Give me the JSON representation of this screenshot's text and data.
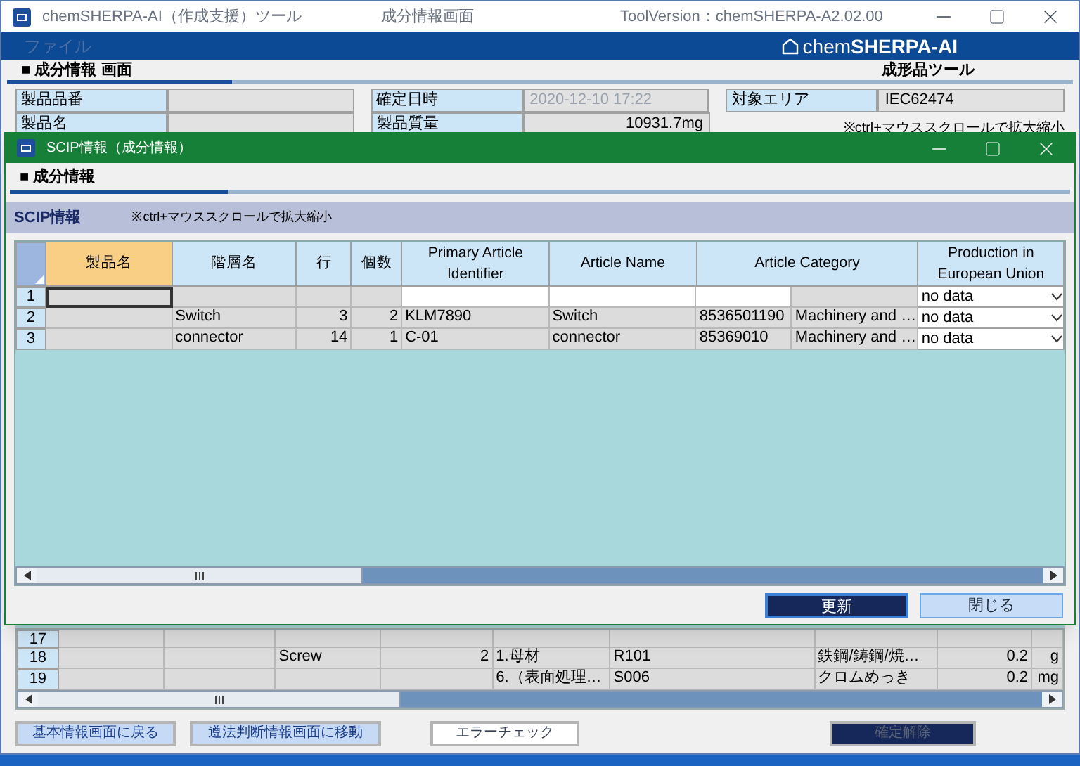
{
  "window": {
    "title": "chemSHERPA-AI（作成支援）ツール",
    "screen_name": "成分情報画面",
    "version": "ToolVersion：chemSHERPA-A2.02.00"
  },
  "menu": [
    {
      "label": "ファイル",
      "disabled": true
    }
  ],
  "logo": {
    "prefix": "chem",
    "brand": "SHERPA-AI"
  },
  "section": {
    "title": "■ 成分情報 画面",
    "subtitle": "成形品ツール"
  },
  "info_rows": [
    [
      {
        "label": "製品品番"
      },
      {
        "label": "確定日時",
        "value": "2020-12-10 17:22",
        "disabled": true
      },
      {
        "label": "対象エリア",
        "value": "IEC62474",
        "disabled": false
      }
    ],
    [
      {
        "label": "製品名"
      },
      {
        "label": "製品質量",
        "value": "10931.7mg",
        "disabled": false
      },
      {
        "hint": "※ctrl+マウススクロールで拡大縮小"
      }
    ]
  ],
  "dialog": {
    "title": "SCIP情報（成分情報）",
    "section": "■ 成分情報",
    "bar_title": "SCIP情報",
    "hint": "※ctrl+マウススクロールで拡大縮小",
    "columns": [
      {
        "label": "製品名",
        "selected": true
      },
      {
        "label": "階層名",
        "selected": false
      },
      {
        "label": "行",
        "selected": false
      },
      {
        "label": "個数",
        "selected": false
      },
      {
        "label": "Primary Article Identifier",
        "selected": false
      },
      {
        "label": "Article Name",
        "selected": false
      },
      {
        "label": "Article Category",
        "selected": false
      },
      {
        "label": "Production in European Union",
        "selected": false
      }
    ],
    "rows": [
      {
        "num": "1",
        "focused": true,
        "cells": [
          null,
          null,
          null,
          null,
          null,
          null,
          [
            null,
            null
          ],
          "no data"
        ]
      },
      {
        "num": "2",
        "focused": false,
        "cells": [
          null,
          "Switch",
          "3",
          "2",
          "KLM7890",
          "Switch",
          [
            "8536501190",
            "Machinery and …"
          ],
          "no data"
        ]
      },
      {
        "num": "3",
        "focused": false,
        "cells": [
          null,
          "connector",
          "14",
          "1",
          "C-01",
          "connector",
          [
            "85369010",
            "Machinery and …"
          ],
          "no data"
        ]
      }
    ],
    "buttons": [
      {
        "label": "更新",
        "kind": "primary"
      },
      {
        "label": "閉じる",
        "kind": "secondary"
      }
    ]
  },
  "lower_rows": [
    {
      "num": "17",
      "cells": [
        null,
        null,
        null,
        null,
        null,
        null,
        null,
        null,
        null
      ]
    },
    {
      "num": "18",
      "cells": [
        null,
        null,
        "Screw",
        "2",
        "1.母材",
        "R101",
        "鉄鋼/鋳鋼/焼…",
        "0.2",
        "g"
      ]
    },
    {
      "num": "19",
      "cells": [
        null,
        null,
        null,
        null,
        "6.（表面処理…",
        "S006",
        "クロムめっき",
        "0.2",
        "mg"
      ]
    }
  ],
  "buttons": [
    {
      "label": "基本情報画面に戻る",
      "kind": "light"
    },
    {
      "label": "遵法判断情報画面に移動",
      "kind": "light"
    },
    {
      "label": "エラーチェック",
      "kind": "white"
    },
    {
      "label": "確定解除",
      "kind": "dark"
    }
  ]
}
